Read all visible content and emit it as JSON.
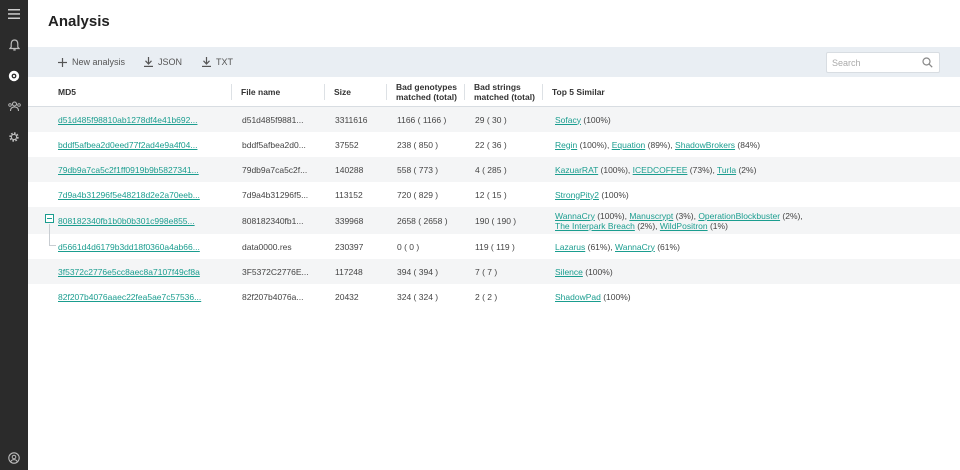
{
  "page": {
    "title": "Analysis"
  },
  "sidebar": {
    "icons": [
      "menu-icon",
      "bell-icon",
      "analysis-icon",
      "users-icon",
      "gear-icon",
      "account-icon"
    ]
  },
  "toolbar": {
    "new_analysis": "New analysis",
    "json": "JSON",
    "txt": "TXT",
    "search_placeholder": "Search"
  },
  "table": {
    "columns": {
      "md5": "MD5",
      "file_name": "File name",
      "size": "Size",
      "bad_genotypes_1": "Bad genotypes",
      "bad_genotypes_2": "matched (total)",
      "bad_strings_1": "Bad strings",
      "bad_strings_2": "matched (total)",
      "top5": "Top 5 Similar"
    },
    "rows": [
      {
        "md5": "d51d485f98810ab1278df4e41b692...",
        "file": "d51d485f9881...",
        "size": "3311616",
        "genotypes": "1166 ( 1166 )",
        "strings": "29 ( 30 )",
        "similar": [
          {
            "name": "Sofacy",
            "pct": " (100%)"
          }
        ]
      },
      {
        "md5": "bddf5afbea2d0eed77f2ad4e9a4f04...",
        "file": "bddf5afbea2d0...",
        "size": "37552",
        "genotypes": "238 ( 850 )",
        "strings": "22 ( 36 )",
        "similar": [
          {
            "name": "Regin",
            "pct": " (100%), "
          },
          {
            "name": "Equation",
            "pct": " (89%), "
          },
          {
            "name": "ShadowBrokers",
            "pct": " (84%)"
          }
        ]
      },
      {
        "md5": "79db9a7ca5c2f1ff0919b9b5827341...",
        "file": "79db9a7ca5c2f...",
        "size": "140288",
        "genotypes": "558 ( 773 )",
        "strings": "4 ( 285 )",
        "similar": [
          {
            "name": "KazuarRAT",
            "pct": " (100%), "
          },
          {
            "name": "ICEDCOFFEE",
            "pct": " (73%), "
          },
          {
            "name": "Turla",
            "pct": " (2%)"
          }
        ]
      },
      {
        "md5": "7d9a4b31296f5e48218d2e2a70eeb...",
        "file": "7d9a4b31296f5...",
        "size": "113152",
        "genotypes": "720 ( 829 )",
        "strings": "12 ( 15 )",
        "similar": [
          {
            "name": "StrongPity2",
            "pct": " (100%)"
          }
        ]
      },
      {
        "md5": "808182340fb1b0b0b301c998e855...",
        "file": "808182340fb1...",
        "size": "339968",
        "genotypes": "2658 ( 2658 )",
        "strings": "190 ( 190 )",
        "similar": [
          {
            "name": "WannaCry",
            "pct": " (100%), "
          },
          {
            "name": "Manuscrypt",
            "pct": " (3%), "
          },
          {
            "name": "OperationBlockbuster",
            "pct": " (2%), "
          },
          {
            "name": "The Interpark Breach",
            "pct": " (2%), "
          },
          {
            "name": "WildPositron",
            "pct": " (1%)"
          }
        ]
      },
      {
        "md5": "d5661d4d6179b3dd18f0360a4ab66...",
        "file": "data0000.res",
        "size": "230397",
        "genotypes": "0 ( 0 )",
        "strings": "119 ( 119 )",
        "similar": [
          {
            "name": "Lazarus",
            "pct": " (61%), "
          },
          {
            "name": "WannaCry",
            "pct": " (61%)"
          }
        ]
      },
      {
        "md5": "3f5372c2776e5cc8aec8a7107f49cf8a",
        "file": "3F5372C2776E...",
        "size": "117248",
        "genotypes": "394 ( 394 )",
        "strings": "7 ( 7 )",
        "similar": [
          {
            "name": "Silence",
            "pct": " (100%)"
          }
        ]
      },
      {
        "md5": "82f207b4076aaec22fea5ae7c57536...",
        "file": "82f207b4076a...",
        "size": "20432",
        "genotypes": "324 ( 324 )",
        "strings": "2 ( 2 )",
        "similar": [
          {
            "name": "ShadowPad",
            "pct": " (100%)"
          }
        ]
      }
    ]
  }
}
